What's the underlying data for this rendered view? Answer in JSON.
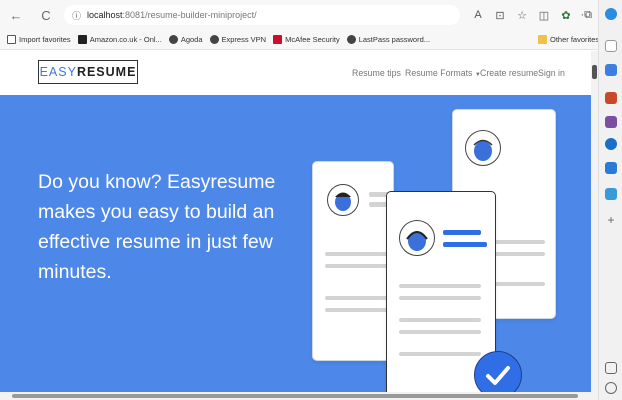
{
  "browser": {
    "url_host": "localhost",
    "url_path": ":8081/resume-builder-miniproject/",
    "bookmarks": [
      {
        "label": "Import favorites",
        "color": "#555"
      },
      {
        "label": "Amazon.co.uk - Onl...",
        "color": "#222"
      },
      {
        "label": "Agoda",
        "color": "#444"
      },
      {
        "label": "Express VPN",
        "color": "#444"
      },
      {
        "label": "McAfee Security",
        "color": "#c8102e"
      },
      {
        "label": "LastPass password...",
        "color": "#444"
      }
    ],
    "other_favorites": "Other favorites",
    "icons": {
      "back": "←",
      "refresh": "C",
      "info": "ⓘ",
      "read_aloud": "A",
      "split": "⊡",
      "favorite": "☆",
      "tabs": "◫",
      "collections": "✩",
      "history": "⧉",
      "extension": "✿",
      "more": "···"
    }
  },
  "nav": {
    "logo_light": "EASY",
    "logo_bold": "RESUME",
    "items": [
      "Resume tips",
      "Resume Formats",
      "Create resume",
      "Sign in"
    ],
    "dropdown_caret": "▼"
  },
  "hero": {
    "headline": "Do you know? Easyresume makes you easy to build an effective resume in just few minutes.",
    "accent_color": "#4d88e8",
    "check_color": "#2f6ee6"
  }
}
